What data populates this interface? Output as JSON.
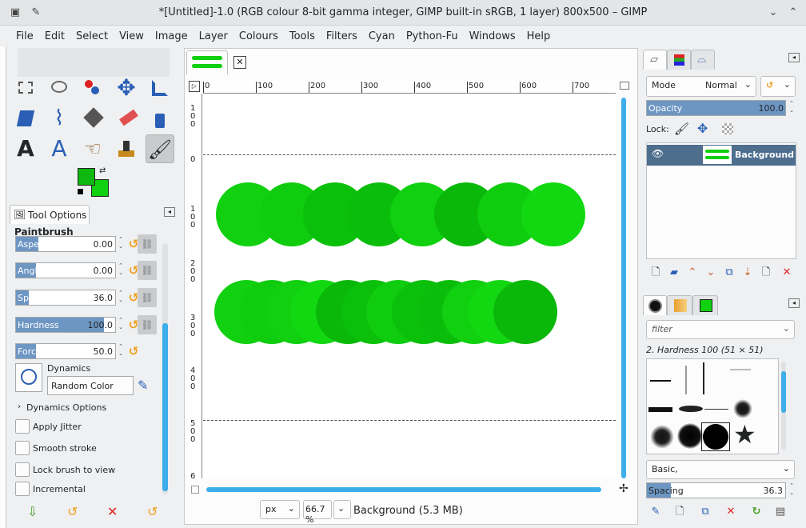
{
  "window": {
    "title": "*[Untitled]-1.0 (RGB colour 8-bit gamma integer, GIMP built-in sRGB, 1 layer) 800x500 – GIMP"
  },
  "menu": [
    "File",
    "Edit",
    "Select",
    "View",
    "Image",
    "Layer",
    "Colours",
    "Tools",
    "Filters",
    "Cyan",
    "Python-Fu",
    "Windows",
    "Help"
  ],
  "colors": {
    "foreground": "#0eb80e",
    "background": "#10d010",
    "accent": "#3daee9",
    "slider_fill": "#6d96c3"
  },
  "tool_options": {
    "tab_label": "Tool Options",
    "tool_name": "Paintbrush",
    "sliders": [
      {
        "label": "Aspect Ratio",
        "value": "0.00",
        "fill": 0.5
      },
      {
        "label": "Angle",
        "value": "0.00",
        "fill": 0.45
      },
      {
        "label": "Spacing",
        "value": "36.0",
        "fill": 0.29
      },
      {
        "label": "Hardness",
        "value": "100.0",
        "fill": 1.0
      },
      {
        "label": "Force",
        "value": "50.0",
        "fill": 0.45
      }
    ],
    "dynamics_label": "Dynamics",
    "dynamics_value": "Random Color",
    "dynamics_options": "Dynamics Options",
    "checks": [
      "Apply Jitter",
      "Smooth stroke",
      "Lock brush to view",
      "Incremental"
    ]
  },
  "ruler": {
    "h": [
      "0",
      "100",
      "200",
      "300",
      "400",
      "500",
      "600",
      "700"
    ],
    "v": [
      "0",
      "1 0 0",
      "2 0 0",
      "3 0 0",
      "4 0 0",
      "5 0 0",
      "6"
    ],
    "vtop": [
      "1",
      "0",
      "0"
    ]
  },
  "statusbar": {
    "unit": "px",
    "zoom": "66.7 %",
    "info": "Background (5.3 MB)"
  },
  "layers": {
    "mode_label": "Mode",
    "mode_value": "Normal",
    "opacity_label": "Opacity",
    "opacity_value": "100.0",
    "lock_label": "Lock:",
    "layer_name": "Background"
  },
  "brushes": {
    "filter_placeholder": "filter",
    "selected": "2. Hardness 100 (51 × 51)",
    "tag": "Basic,",
    "spacing_label": "Spacing",
    "spacing_value": "36.3"
  },
  "strokes": {
    "row1": [
      "#10d010",
      "#0fcc0f",
      "#0ac00a",
      "#0bbd0b",
      "#10d010",
      "#0ab80a",
      "#0fcc0f",
      "#12d812"
    ],
    "row2": [
      "#10d010",
      "#0fcc0f",
      "#10d010",
      "#12d812",
      "#0ab80a",
      "#0ac00a",
      "#0fcc0f",
      "#0ac00a",
      "#0bbd0b",
      "#10d010",
      "#12d812",
      "#0ab80a"
    ]
  }
}
